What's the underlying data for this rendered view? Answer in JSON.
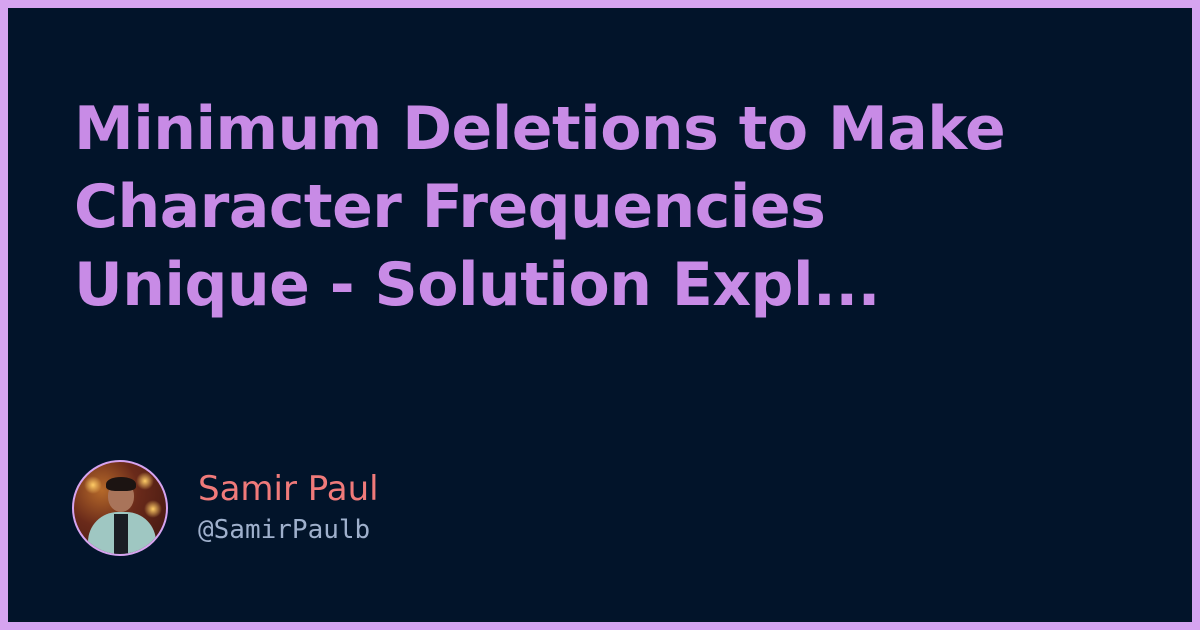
{
  "title_lines": [
    "Minimum Deletions to Make",
    "Character Frequencies",
    "Unique - Solution Expl..."
  ],
  "author": {
    "name": "Samir Paul",
    "handle": "@SamirPaulb"
  },
  "colors": {
    "border": "#d6a4f0",
    "background": "#02142a",
    "title": "#c88be6",
    "author_name": "#f07a7a",
    "author_handle": "#9fb0cc"
  }
}
